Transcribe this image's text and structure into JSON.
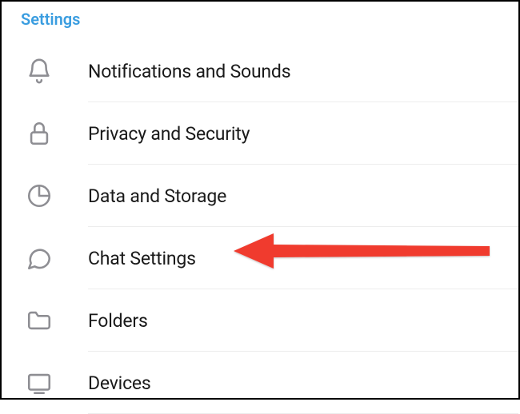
{
  "section_title": "Settings",
  "items": [
    {
      "label": "Notifications and Sounds",
      "icon": "bell-icon"
    },
    {
      "label": "Privacy and Security",
      "icon": "lock-icon"
    },
    {
      "label": "Data and Storage",
      "icon": "pie-icon"
    },
    {
      "label": "Chat Settings",
      "icon": "chat-icon"
    },
    {
      "label": "Folders",
      "icon": "folder-icon"
    },
    {
      "label": "Devices",
      "icon": "device-icon"
    }
  ],
  "annotation": {
    "highlight_index": 3,
    "color": "#f03a2f"
  }
}
